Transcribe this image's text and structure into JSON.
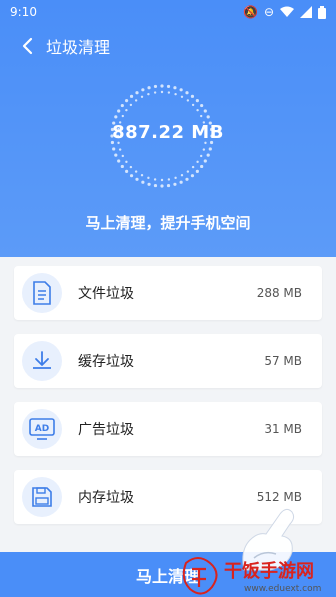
{
  "status": {
    "time": "9:10",
    "icons": [
      "bell-off-icon",
      "dnd-icon",
      "wifi-icon",
      "signal-icon",
      "battery-icon"
    ]
  },
  "header": {
    "title": "垃圾清理",
    "size": "887.22 MB",
    "subtitle": "马上清理，提升手机空间"
  },
  "items": [
    {
      "label": "文件垃圾",
      "value": "288 MB",
      "icon": "document-icon"
    },
    {
      "label": "缓存垃圾",
      "value": "57 MB",
      "icon": "download-icon"
    },
    {
      "label": "广告垃圾",
      "value": "31 MB",
      "icon": "ad-icon"
    },
    {
      "label": "内存垃圾",
      "value": "512 MB",
      "icon": "save-icon"
    }
  ],
  "action": {
    "clean_label": "马上清理"
  },
  "watermark": {
    "text": "干饭手游网",
    "url": "www.eduext.com"
  },
  "colors": {
    "primary": "#4a8ef8",
    "icon_bg": "#e8f0fd"
  }
}
